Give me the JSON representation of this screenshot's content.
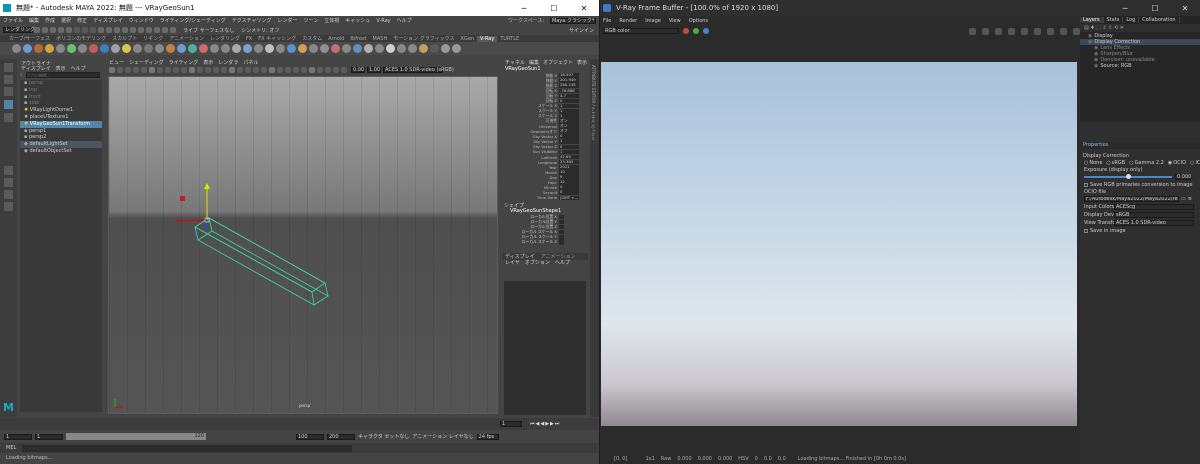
{
  "maya": {
    "title": "無題* - Autodesk MAYA 2022: 無題  ---  VRayGeoSun1",
    "window_buttons": [
      "─",
      "☐",
      "✕"
    ],
    "menu": [
      "ファイル",
      "編集",
      "作成",
      "選択",
      "修正",
      "ディスプレイ",
      "ウィンドウ",
      "ライティング/シェーディング",
      "テクスチャリング",
      "レンダー",
      "ツーン",
      "立体視",
      "キャッシュ",
      "V-Ray",
      "ヘルプ"
    ],
    "workspace_label": "ワークスペース:",
    "workspace_value": "Maya クラシック*",
    "mode_menu": "レンダリング",
    "live_label": "ライブ サーフェスなし",
    "symmetry_label": "シンメトリ: オフ",
    "signin": "サインイン",
    "shelf_tabs": [
      "カーブ/サーフェス",
      "ポリゴンのモデリング",
      "スカルプト",
      "リギング",
      "アニメーション",
      "レンダリング",
      "FX",
      "FX キャッシング",
      "カスタム",
      "Arnold",
      "Bifrost",
      "MASH",
      "モーション グラフィックス",
      "XGen",
      "V-Ray",
      "TURTLE"
    ],
    "outliner": {
      "title": "アウトライナ",
      "menu": [
        "ディスプレイ",
        "表示",
        "ヘルプ"
      ],
      "search_placeholder": "ここに検索...",
      "items": [
        "persp",
        "top",
        "front",
        "side",
        "VRayLightDome1",
        "placeUTexture1",
        "VRayGeoSun1Transform",
        "persp1",
        "persp2",
        "defaultLightSet",
        "defaultObjectSet"
      ]
    },
    "viewport": {
      "menu": [
        "ビュー",
        "シェーディング",
        "ライティング",
        "表示",
        "レンダラ",
        "パネル"
      ],
      "gamma": "1.00",
      "exposure": "0.00",
      "colorspace": "ACES 1.0 SDR-video (sRGB)",
      "camera_label": "persp"
    },
    "channels": {
      "tabs": [
        "チャネル",
        "編集",
        "オブジェクト",
        "表示"
      ],
      "object": "VRayGeoSun1",
      "rows": [
        [
          "移動 X",
          "16.507"
        ],
        [
          "移動 Y",
          "201.949"
        ],
        [
          "移動 Z",
          "280.145"
        ],
        [
          "回転 X",
          "-76.868"
        ],
        [
          "回転 Y",
          "4.7"
        ],
        [
          "回転 Z",
          "0"
        ],
        [
          "スケール X",
          "1"
        ],
        [
          "スケール Y",
          "1"
        ],
        [
          "スケール Z",
          "1"
        ],
        [
          "可視性",
          "オン"
        ],
        [
          "Universal",
          "オン"
        ],
        [
          "Geometryオフ",
          "オフ"
        ],
        [
          "Sky Vector X",
          "0"
        ],
        [
          "Sky Vector Y",
          "1"
        ],
        [
          "Sky Vector Z",
          "0"
        ],
        [
          "Sun Visibility",
          "1"
        ],
        [
          "Latitude",
          "42.65"
        ],
        [
          "Longitude",
          "23.383"
        ],
        [
          "Year",
          "2021"
        ],
        [
          "Month",
          "10"
        ],
        [
          "Day",
          "9"
        ],
        [
          "Hour",
          "12"
        ],
        [
          "Minute",
          "0"
        ],
        [
          "Second",
          "0"
        ],
        [
          "Time Zone",
          "[GMT +..."
        ]
      ],
      "shapes_title": "シェイプ",
      "shape_object": "VRayGeoSunShape1",
      "shape_rows": [
        "ローカル位置 X",
        "ローカル位置 Y",
        "ローカル位置 Z",
        "ローカル スケール X",
        "ローカル スケール Y",
        "ローカル スケール Z"
      ],
      "layers_tabs": [
        "ディスプレイ",
        "アニメーション"
      ],
      "layers_menu": [
        "レイヤ",
        "オプション",
        "ヘルプ"
      ]
    },
    "timeline": {
      "start": "1",
      "end": "120",
      "range_start": "1",
      "range_end": "120",
      "anim_end": "100",
      "anim_end2": "200",
      "current": "1",
      "char_set": "キャラクタ セットなし",
      "anim_layer": "アニメーション レイヤなし",
      "fps": "24 fps"
    },
    "command": {
      "label": "MEL",
      "status": "Loading bitmaps..."
    },
    "side_panel": "ATTRIBUTE EDITOR / チャネル ボックス"
  },
  "vfb": {
    "title": "V-Ray Frame Buffer - [100.0% of 1920 x 1080]",
    "menu": [
      "File",
      "Render",
      "Image",
      "View",
      "Options"
    ],
    "channel": "RGB color",
    "tabs": [
      "Layers",
      "Stats",
      "Log",
      "Collaboration"
    ],
    "layers": [
      "Display",
      "Display Correction",
      "Lens Effects",
      "Sharpen/Blur",
      "Denoiser: unavailable",
      "Source: RGB"
    ],
    "properties": {
      "title": "Properties",
      "section": "Display Correction",
      "modes": [
        "None",
        "sRGB",
        "Gamma 2.2",
        "OCIO",
        "ICC"
      ],
      "mode_selected": "OCIO",
      "exposure_label": "Exposure (display only)",
      "exposure_value": "0.000",
      "save_rgb": "Save RGB primaries conversion to image",
      "ocio_file_label": "OCIO file",
      "ocio_file": "F:/Autodesk/Maya2022/Maya2022/resources/...",
      "input_cs_label": "Input Colorspace",
      "input_cs": "ACEScg",
      "display_label": "Display Device",
      "display": "sRGB",
      "view_label": "View Transform",
      "view": "ACES 1.0 SDR-video",
      "save_in_image": "Save in image"
    },
    "status": {
      "coords": "[0, 0]",
      "mode": "1x1",
      "raw": "Raw",
      "r": "0.000",
      "g": "0.000",
      "b": "0.000",
      "hsv": "HSV",
      "h": "0",
      "s": "0.0",
      "v": "0.0",
      "message": "Loading bitmaps... Finished in [0h 0m 0.0s]"
    }
  },
  "colors": {
    "maya_bg": "#444444",
    "viewport_top": "#a9a9a9",
    "viewport_floor": "#555555",
    "selection": "#5285a6",
    "sun_wire": "#3bd9a4",
    "vfb_bg": "#2b2b2b"
  }
}
